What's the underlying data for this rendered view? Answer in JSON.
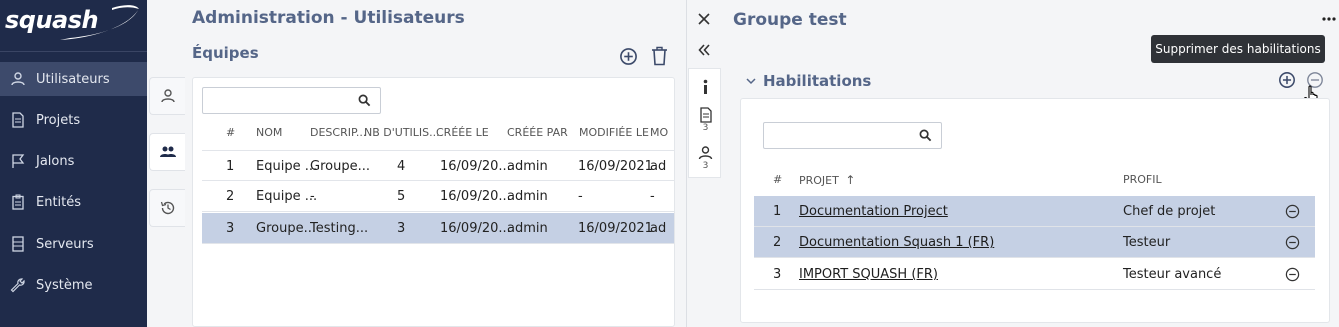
{
  "app": {
    "logo_text": "squash"
  },
  "sidebar": {
    "items": [
      {
        "label": "Utilisateurs",
        "icon": "user-icon",
        "active": true
      },
      {
        "label": "Projets",
        "icon": "document-icon",
        "active": false
      },
      {
        "label": "Jalons",
        "icon": "flag-icon",
        "active": false
      },
      {
        "label": "Entités",
        "icon": "clipboard-icon",
        "active": false
      },
      {
        "label": "Serveurs",
        "icon": "server-icon",
        "active": false
      },
      {
        "label": "Système",
        "icon": "wrench-icon",
        "active": false
      }
    ]
  },
  "page": {
    "title": "Administration - Utilisateurs",
    "subtitle": "Équipes"
  },
  "teams_table": {
    "search_placeholder": "",
    "headers": [
      "#",
      "NOM",
      "DESCRIP...",
      "NB D'UTILIS...",
      "CRÉÉE LE",
      "CRÉÉE PAR",
      "MODIFIÉE LE",
      "MO"
    ],
    "rows": [
      {
        "num": "1",
        "name": "Equipe ...",
        "desc": "Groupe...",
        "users": "4",
        "created": "16/09/20...",
        "created_by": "admin",
        "modified": "16/09/2021",
        "mod_by": "ad"
      },
      {
        "num": "2",
        "name": "Equipe ...",
        "desc": "-",
        "users": "5",
        "created": "16/09/20...",
        "created_by": "admin",
        "modified": "-",
        "mod_by": "-"
      },
      {
        "num": "3",
        "name": "Groupe...",
        "desc": "Testing...",
        "users": "3",
        "created": "16/09/20...",
        "created_by": "admin",
        "modified": "16/09/2021",
        "mod_by": "ad"
      }
    ]
  },
  "detail": {
    "title": "Groupe test",
    "tab_counts": {
      "documents": "3",
      "users": "3"
    },
    "section_title": "Habilitations",
    "tooltip": "Supprimer des habilitations",
    "search_placeholder": "",
    "headers": {
      "num": "#",
      "project": "PROJET",
      "sort_arrow": "↑",
      "profile": "PROFIL"
    },
    "rows": [
      {
        "num": "1",
        "project": "Documentation Project",
        "profile": "Chef de projet"
      },
      {
        "num": "2",
        "project": "Documentation Squash 1 (FR)",
        "profile": "Testeur"
      },
      {
        "num": "3",
        "project": "IMPORT SQUASH (FR)",
        "profile": "Testeur avancé"
      }
    ]
  }
}
